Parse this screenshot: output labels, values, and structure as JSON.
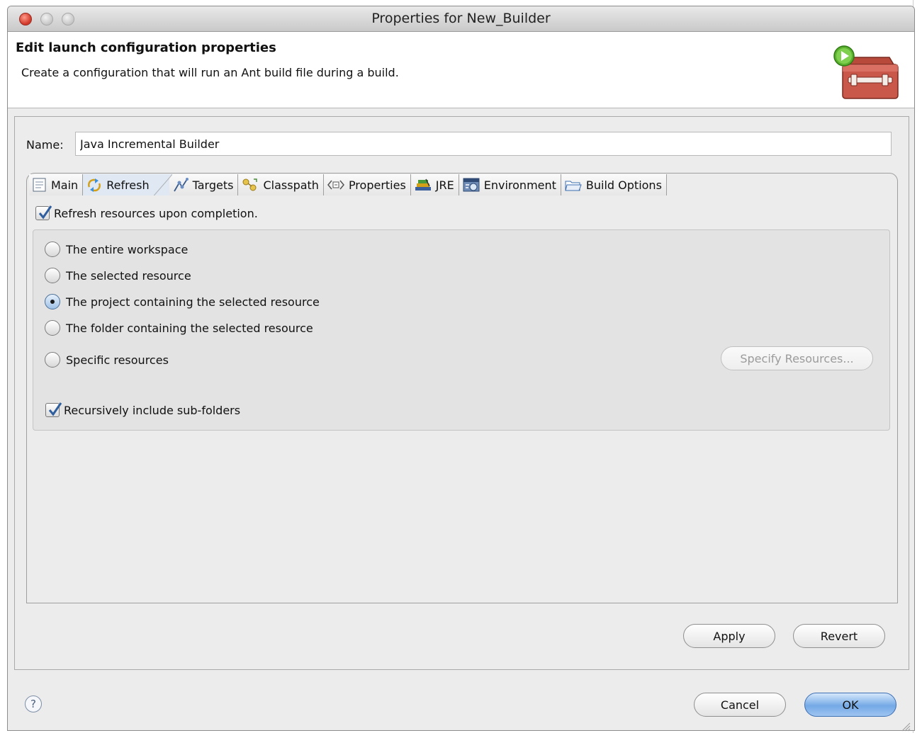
{
  "window": {
    "title": "Properties for New_Builder"
  },
  "header": {
    "title": "Edit launch configuration properties",
    "description": "Create a configuration that will run an Ant build file during a build."
  },
  "form": {
    "name_label": "Name:",
    "name_value": "Java Incremental Builder"
  },
  "tabs": [
    {
      "label": "Main",
      "icon": "document-icon",
      "active": false
    },
    {
      "label": "Refresh",
      "icon": "refresh-icon",
      "active": true
    },
    {
      "label": "Targets",
      "icon": "targets-icon",
      "active": false
    },
    {
      "label": "Classpath",
      "icon": "classpath-icon",
      "active": false
    },
    {
      "label": "Properties",
      "icon": "properties-icon",
      "active": false
    },
    {
      "label": "JRE",
      "icon": "jre-icon",
      "active": false
    },
    {
      "label": "Environment",
      "icon": "environment-icon",
      "active": false
    },
    {
      "label": "Build Options",
      "icon": "folder-icon",
      "active": false
    }
  ],
  "refresh": {
    "refresh_label": "Refresh resources upon completion.",
    "refresh_checked": true,
    "options": [
      {
        "label": "The entire workspace",
        "selected": false
      },
      {
        "label": "The selected resource",
        "selected": false
      },
      {
        "label": "The project containing the selected resource",
        "selected": true
      },
      {
        "label": "The folder containing the selected resource",
        "selected": false
      },
      {
        "label": "Specific resources",
        "selected": false
      }
    ],
    "specify_button": "Specify Resources...",
    "recursive_label": "Recursively include sub-folders",
    "recursive_checked": true
  },
  "actions": {
    "apply": "Apply",
    "revert": "Revert",
    "cancel": "Cancel",
    "ok": "OK"
  },
  "help": {
    "glyph": "?"
  },
  "colors": {
    "default_button": "#74a9e6",
    "close_light": "#d23a2a",
    "window_bg": "#ececec"
  }
}
